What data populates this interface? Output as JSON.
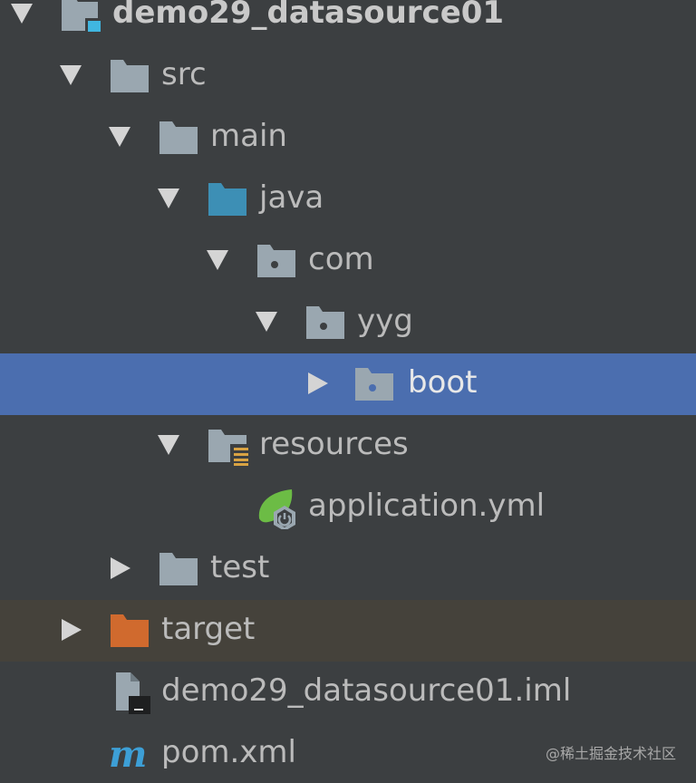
{
  "tree": {
    "nodes": [
      {
        "label": "demo29_datasource01",
        "icon": "module-folder-icon",
        "expanded": true
      },
      {
        "label": "src",
        "icon": "folder-icon",
        "expanded": true
      },
      {
        "label": "main",
        "icon": "folder-icon",
        "expanded": true
      },
      {
        "label": "java",
        "icon": "source-root-folder-icon",
        "expanded": true
      },
      {
        "label": "com",
        "icon": "package-icon",
        "expanded": true
      },
      {
        "label": "yyg",
        "icon": "package-icon",
        "expanded": true
      },
      {
        "label": "boot",
        "icon": "package-icon",
        "expanded": false,
        "selected": true
      },
      {
        "label": "resources",
        "icon": "resources-folder-icon",
        "expanded": true
      },
      {
        "label": "application.yml",
        "icon": "spring-config-icon"
      },
      {
        "label": "test",
        "icon": "folder-icon",
        "expanded": false
      },
      {
        "label": "target",
        "icon": "excluded-folder-icon",
        "expanded": false,
        "excluded": true
      },
      {
        "label": "demo29_datasource01.iml",
        "icon": "iml-file-icon"
      },
      {
        "label": "pom.xml",
        "icon": "maven-icon"
      }
    ]
  },
  "colors": {
    "background": "#3c3f41",
    "selection": "#4b6eaf",
    "excluded_row": "#45423b",
    "folder": "#9aa7b0",
    "source_root": "#3d8fb5",
    "excluded_folder": "#d06a2e",
    "spring": "#6cbc45"
  },
  "watermark": "@稀土掘金技术社区"
}
